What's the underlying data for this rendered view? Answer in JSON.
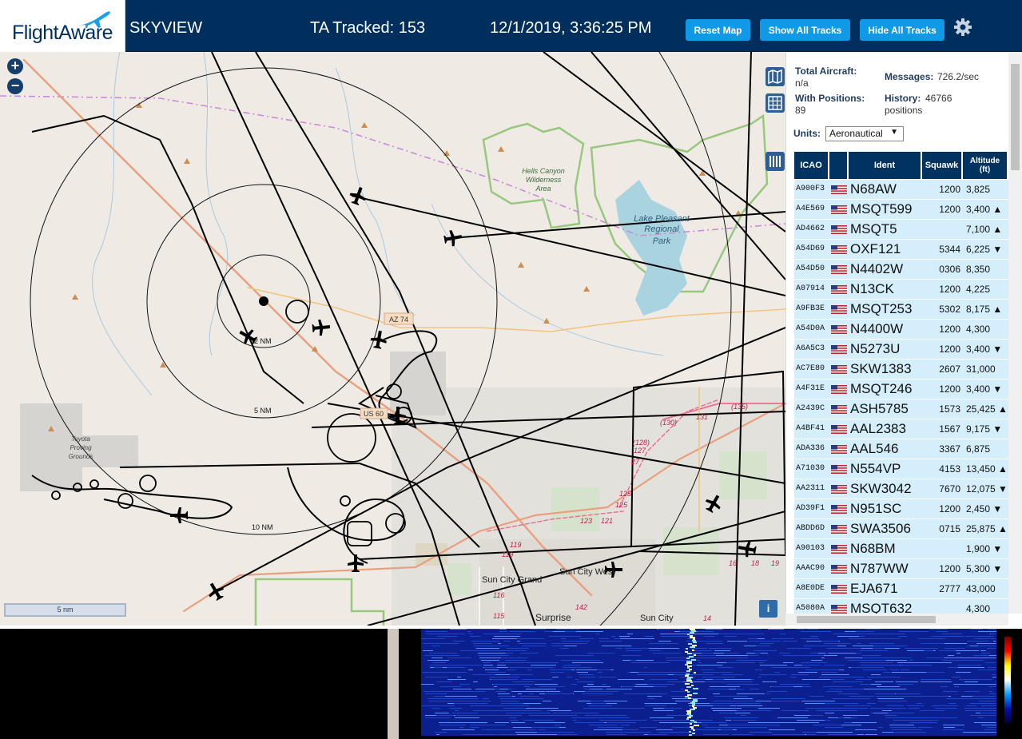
{
  "header": {
    "logo_text": "FlightAware",
    "app_name": "SKYVIEW",
    "tracked": "TA Tracked: 153",
    "datetime": "12/1/2019, 3:36:25 PM",
    "buttons": {
      "reset": "Reset Map",
      "show": "Show All Tracks",
      "hide": "Hide All Tracks"
    },
    "settings_icon": "gear-icon"
  },
  "map": {
    "zoom_in": "+",
    "zoom_out": "−",
    "scale_label": "5 nm",
    "info": "i",
    "range_labels": [
      "2 NM",
      "5 NM",
      "10 NM"
    ],
    "place_labels": [
      {
        "id": "hells",
        "lines": [
          "Hells Canyon",
          "Wilderness",
          "Area"
        ]
      },
      {
        "id": "lake",
        "lines": [
          "Lake Pleasant",
          "Regional",
          "Park"
        ]
      },
      {
        "id": "toyota",
        "lines": [
          "Toyota",
          "Proving",
          "Grounds"
        ]
      },
      {
        "id": "suncitygrand",
        "lines": [
          "Sun City Grand"
        ]
      },
      {
        "id": "suncitywest",
        "lines": [
          "Sun City West"
        ]
      },
      {
        "id": "surprise",
        "lines": [
          "Surprise"
        ]
      },
      {
        "id": "suncity",
        "lines": [
          "Sun City"
        ]
      }
    ],
    "road_labels": [
      "AZ 74",
      "US 60",
      "(130)",
      "131",
      "(135)",
      "(128)",
      "127",
      "27",
      "125",
      "125",
      "123",
      "121",
      "119",
      "119",
      "116",
      "115",
      "142",
      "14",
      "16",
      "18",
      "19"
    ]
  },
  "stats": {
    "total_label": "Total Aircraft:",
    "total_value": "n/a",
    "messages_label": "Messages:",
    "messages_value": "726.2/sec",
    "positions_label": "With Positions:",
    "positions_value": "89",
    "history_label": "History:",
    "history_value": "46766",
    "history_unit": "positions"
  },
  "units": {
    "label": "Units:",
    "selected": "Aeronautical"
  },
  "table": {
    "headers": {
      "icao": "ICAO",
      "flag": "",
      "ident": "Ident",
      "squawk": "Squawk",
      "altitude": "Altitude (ft)"
    },
    "rows": [
      {
        "icao": "A900F3",
        "ident": "N68AW",
        "squawk": "1200",
        "alt": "3,825",
        "trend": ""
      },
      {
        "icao": "A4E569",
        "ident": "MSQT599",
        "squawk": "1200",
        "alt": "3,400",
        "trend": "▲"
      },
      {
        "icao": "AD4662",
        "ident": "MSQT5",
        "squawk": "",
        "alt": "7,100",
        "trend": "▲"
      },
      {
        "icao": "A54D69",
        "ident": "OXF121",
        "squawk": "5344",
        "alt": "6,225",
        "trend": "▼"
      },
      {
        "icao": "A54D50",
        "ident": "N4402W",
        "squawk": "0306",
        "alt": "8,350",
        "trend": ""
      },
      {
        "icao": "A07914",
        "ident": "N13CK",
        "squawk": "1200",
        "alt": "4,225",
        "trend": ""
      },
      {
        "icao": "A9FB3E",
        "ident": "MSQT253",
        "squawk": "5302",
        "alt": "8,175",
        "trend": "▲"
      },
      {
        "icao": "A54D0A",
        "ident": "N4400W",
        "squawk": "1200",
        "alt": "4,300",
        "trend": ""
      },
      {
        "icao": "A6A5C3",
        "ident": "N5273U",
        "squawk": "1200",
        "alt": "3,400",
        "trend": "▼"
      },
      {
        "icao": "AC7E80",
        "ident": "SKW1383",
        "squawk": "2607",
        "alt": "31,000",
        "trend": ""
      },
      {
        "icao": "A4F31E",
        "ident": "MSQT246",
        "squawk": "1200",
        "alt": "3,400",
        "trend": "▼"
      },
      {
        "icao": "A2439C",
        "ident": "ASH5785",
        "squawk": "1573",
        "alt": "25,425",
        "trend": "▲"
      },
      {
        "icao": "A4BF41",
        "ident": "AAL2383",
        "squawk": "1567",
        "alt": "9,175",
        "trend": "▼"
      },
      {
        "icao": "ADA336",
        "ident": "AAL546",
        "squawk": "3367",
        "alt": "6,875",
        "trend": ""
      },
      {
        "icao": "A71030",
        "ident": "N554VP",
        "squawk": "4153",
        "alt": "13,450",
        "trend": "▲"
      },
      {
        "icao": "AA2311",
        "ident": "SKW3042",
        "squawk": "7670",
        "alt": "12,075",
        "trend": "▼"
      },
      {
        "icao": "AD39F1",
        "ident": "N951SC",
        "squawk": "1200",
        "alt": "2,450",
        "trend": "▼"
      },
      {
        "icao": "ABDD6D",
        "ident": "SWA3506",
        "squawk": "0715",
        "alt": "25,875",
        "trend": "▲"
      },
      {
        "icao": "A90103",
        "ident": "N68BM",
        "squawk": "",
        "alt": "1,900",
        "trend": "▼"
      },
      {
        "icao": "AAAC90",
        "ident": "N787WW",
        "squawk": "1200",
        "alt": "5,300",
        "trend": "▼"
      },
      {
        "icao": "A8E0DE",
        "ident": "EJA671",
        "squawk": "2777",
        "alt": "43,000",
        "trend": ""
      },
      {
        "icao": "A5080A",
        "ident": "MSQT632",
        "squawk": "",
        "alt": "4,300",
        "trend": ""
      }
    ]
  },
  "colors": {
    "header_bg": "#002f5d",
    "button_bg": "#0f99e6",
    "row_bg": "#d5eefb",
    "table_header": "#00335f",
    "map_bg": "#efebe4"
  }
}
